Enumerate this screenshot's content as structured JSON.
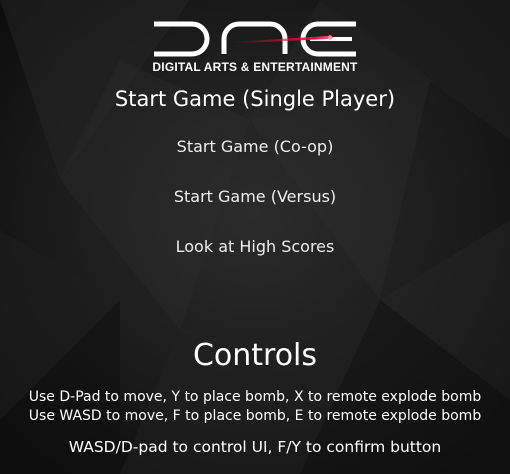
{
  "logo": {
    "mark": "DAE",
    "tagline": "DIGITAL ARTS & ENTERTAINMENT",
    "accent_color": "#e0103a"
  },
  "menu": {
    "items": [
      {
        "label": "Start Game (Single Player)",
        "selected": true
      },
      {
        "label": "Start Game (Co-op)",
        "selected": false
      },
      {
        "label": "Start Game (Versus)",
        "selected": false
      },
      {
        "label": "Look at High Scores",
        "selected": false
      }
    ]
  },
  "controls": {
    "title": "Controls",
    "gamepad_line": "Use D-Pad to move, Y to place bomb, X to remote explode bomb",
    "keyboard_line": "Use WASD to move, F to place bomb, E to remote explode bomb",
    "ui_line": "WASD/D-pad to control UI, F/Y to confirm button"
  },
  "colors": {
    "background": "#141414",
    "text": "#ffffff"
  }
}
